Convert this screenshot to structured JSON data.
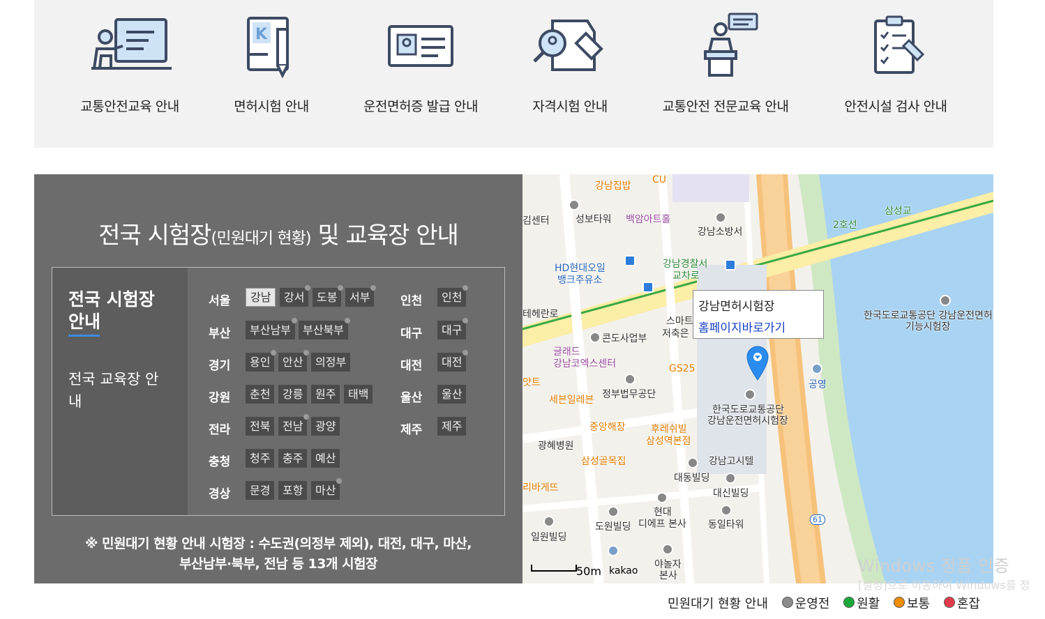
{
  "services": [
    {
      "label": "교통안전교육 안내",
      "icon": "teacher-board-icon"
    },
    {
      "label": "면허시험 안내",
      "icon": "license-book-pencil-icon"
    },
    {
      "label": "운전면허증 발급 안내",
      "icon": "id-card-icon"
    },
    {
      "label": "자격시험 안내",
      "icon": "certificate-search-icon"
    },
    {
      "label": "교통안전 전문교육 안내",
      "icon": "speaker-podium-icon"
    },
    {
      "label": "안전시설 검사 안내",
      "icon": "checklist-clipboard-icon"
    }
  ],
  "panel": {
    "title_main": "전국 시험장",
    "title_small": "(민원대기 현황)",
    "title_end": " 및 교육장 안내",
    "tab_exam": "전국 시험장 안내",
    "tab_edu": "전국 교육장 안내",
    "regions": {
      "seoul": "서울",
      "busan": "부산",
      "gyeonggi": "경기",
      "gangwon": "강원",
      "jeolla": "전라",
      "chungcheong": "충청",
      "gyeongsang": "경상",
      "incheon": "인천",
      "daegu": "대구",
      "daejeon": "대전",
      "ulsan": "울산",
      "jeju": "제주"
    },
    "sites": {
      "gangnam": "강남",
      "gangseo": "강서",
      "dobong": "도봉",
      "seobu": "서부",
      "busan_nambu": "부산남부",
      "busan_bukbu": "부산북부",
      "yongin": "용인",
      "ansan": "안산",
      "uijeongbu": "의정부",
      "chuncheon": "춘천",
      "gangneung": "강릉",
      "wonju": "원주",
      "taebaek": "태백",
      "jeonbuk": "전북",
      "jeonnam": "전남",
      "gwangyang": "광양",
      "cheongju": "청주",
      "chungju": "충주",
      "yesan": "예산",
      "mungyeong": "문경",
      "pohang": "포항",
      "masan": "마산",
      "incheon": "인천",
      "daegu": "대구",
      "daejeon": "대전",
      "ulsan": "울산",
      "jeju": "제주"
    },
    "note_line1": "※ 민원대기 현황 안내 시험장 : 수도권(의정부 제외), 대전, 대구, 마산,",
    "note_line2": "부산남부·북부, 전남 등 13개 시험장"
  },
  "map": {
    "popup_title": "강남면허시험장",
    "popup_link": "홈페이지바로가기",
    "scale": "50m",
    "brand": "kakao",
    "labels": {
      "gangnamjipbap": "강남집밥",
      "cu": "CU",
      "center": "김센터",
      "seongbo": "성보타워",
      "baekam": "백암아트홀",
      "firestation": "강남소방서",
      "samseonggyo": "삼성교",
      "line2": "2호선",
      "hd1": "HD현대오일",
      "hd2": "뱅크주유소",
      "police1": "강남경찰서",
      "police2": "교차로",
      "teheran": "테헤란로",
      "smart1": "스마트",
      "smart2": "저축은",
      "kotsa_test1": "한국도로교통공단 강남운전면허",
      "kotsa_test2": "기능시험장",
      "condo": "콘도사업부",
      "glad1": "글래드",
      "glad2": "강남코엑스센터",
      "gs25": "GS25",
      "yat": "얏트",
      "gongyeong": "공영",
      "justice": "정부법무공단",
      "seven": "세븐일레븐",
      "kotsa1": "한국도로교통공단",
      "kotsa2": "강남운전면허시험장",
      "jungang": "중앙해장",
      "hoorae1": "후레쉬빌",
      "hoorae2": "삼성역본점",
      "gwanghye": "광혜병원",
      "samsung_golmok": "삼성골목집",
      "gangnam_hill": "강남고시텔",
      "daedong": "대동빌딩",
      "daesin": "대신빌딩",
      "barket": "리바게뜨",
      "hyundai1": "현대",
      "hyundai2": "디에프 본사",
      "dowon": "도원빌딩",
      "dongil": "동일타워",
      "ilwon": "일원빌딩",
      "yanolja1": "야놀자",
      "yanolja2": "본사",
      "route61": "61"
    }
  },
  "watermark": {
    "line1": "Windows 정품 인증",
    "line2": "[설정]으로 이동하여 Windows를 정"
  },
  "legend": {
    "title": "민원대기 현황 안내",
    "items": [
      {
        "label": "운영전",
        "color": "#8c8c8c"
      },
      {
        "label": "원활",
        "color": "#1aa83a"
      },
      {
        "label": "보통",
        "color": "#f08c00"
      },
      {
        "label": "혼잡",
        "color": "#e23b4b"
      }
    ]
  }
}
